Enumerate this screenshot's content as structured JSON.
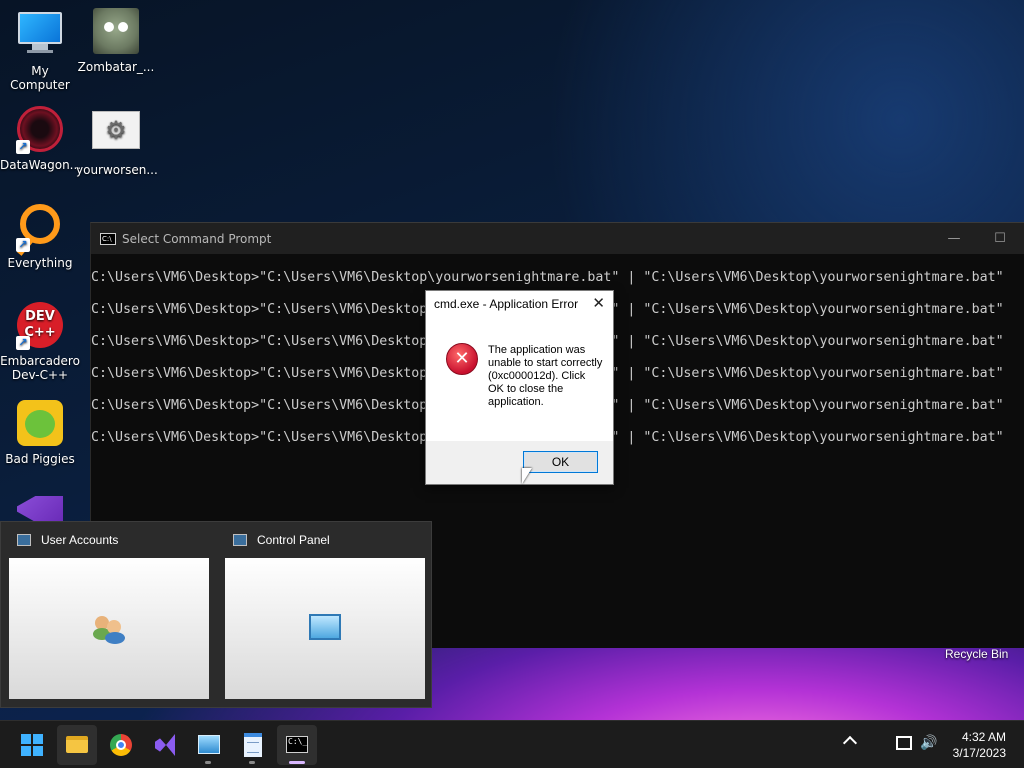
{
  "desktop": {
    "icons": [
      {
        "label": "My Computer"
      },
      {
        "label": "Zombatar_..."
      },
      {
        "label": "DataWagon..."
      },
      {
        "label": "yourworsen..."
      },
      {
        "label": "Everything"
      },
      {
        "label": "Embarcadero Dev-C++"
      },
      {
        "label": "Bad Piggies"
      }
    ],
    "recycle_bin": "Recycle Bin",
    "devcpp_badge": "DEV C++"
  },
  "cmd": {
    "title": "Select Command Prompt",
    "minimize": "—",
    "maximize": "☐",
    "lines": [
      "C:\\Users\\VM6\\Desktop>\"C:\\Users\\VM6\\Desktop\\yourworsenightmare.bat\" | \"C:\\Users\\VM6\\Desktop\\yourworsenightmare.bat\"",
      "C:\\Users\\VM6\\Desktop>\"C:\\Users\\VM6\\Desktop\\yourworsenightmare.bat\" | \"C:\\Users\\VM6\\Desktop\\yourworsenightmare.bat\"",
      "C:\\Users\\VM6\\Desktop>\"C:\\Users\\VM6\\Desktop\\yourworsenightmare.bat\" | \"C:\\Users\\VM6\\Desktop\\yourworsenightmare.bat\"",
      "C:\\Users\\VM6\\Desktop>\"C:\\Users\\VM6\\Desktop\\yourworsenightmare.bat\" | \"C:\\Users\\VM6\\Desktop\\yourworsenightmare.bat\"",
      "C:\\Users\\VM6\\Desktop>\"C:\\Users\\VM6\\Desktop\\yourworsenightmare.bat\" | \"C:\\Users\\VM6\\Desktop\\yourworsenightmare.bat\"",
      "C:\\Users\\VM6\\Desktop>\"C:\\Users\\VM6\\Desktop\\yourworsenightmare.bat\" | \"C:\\Users\\VM6\\Desktop\\yourworsenightmare.bat\""
    ]
  },
  "dialog": {
    "title": "cmd.exe - Application Error",
    "close": "✕",
    "message": "The application was unable to start correctly (0xc000012d). Click OK to close the application.",
    "ok": "OK",
    "error_glyph": "✕"
  },
  "thumbnails": [
    {
      "title": "User Accounts"
    },
    {
      "title": "Control Panel"
    }
  ],
  "taskbar": {
    "time": "4:32 AM",
    "date": "3/17/2023",
    "speaker_glyph": "🔊"
  }
}
